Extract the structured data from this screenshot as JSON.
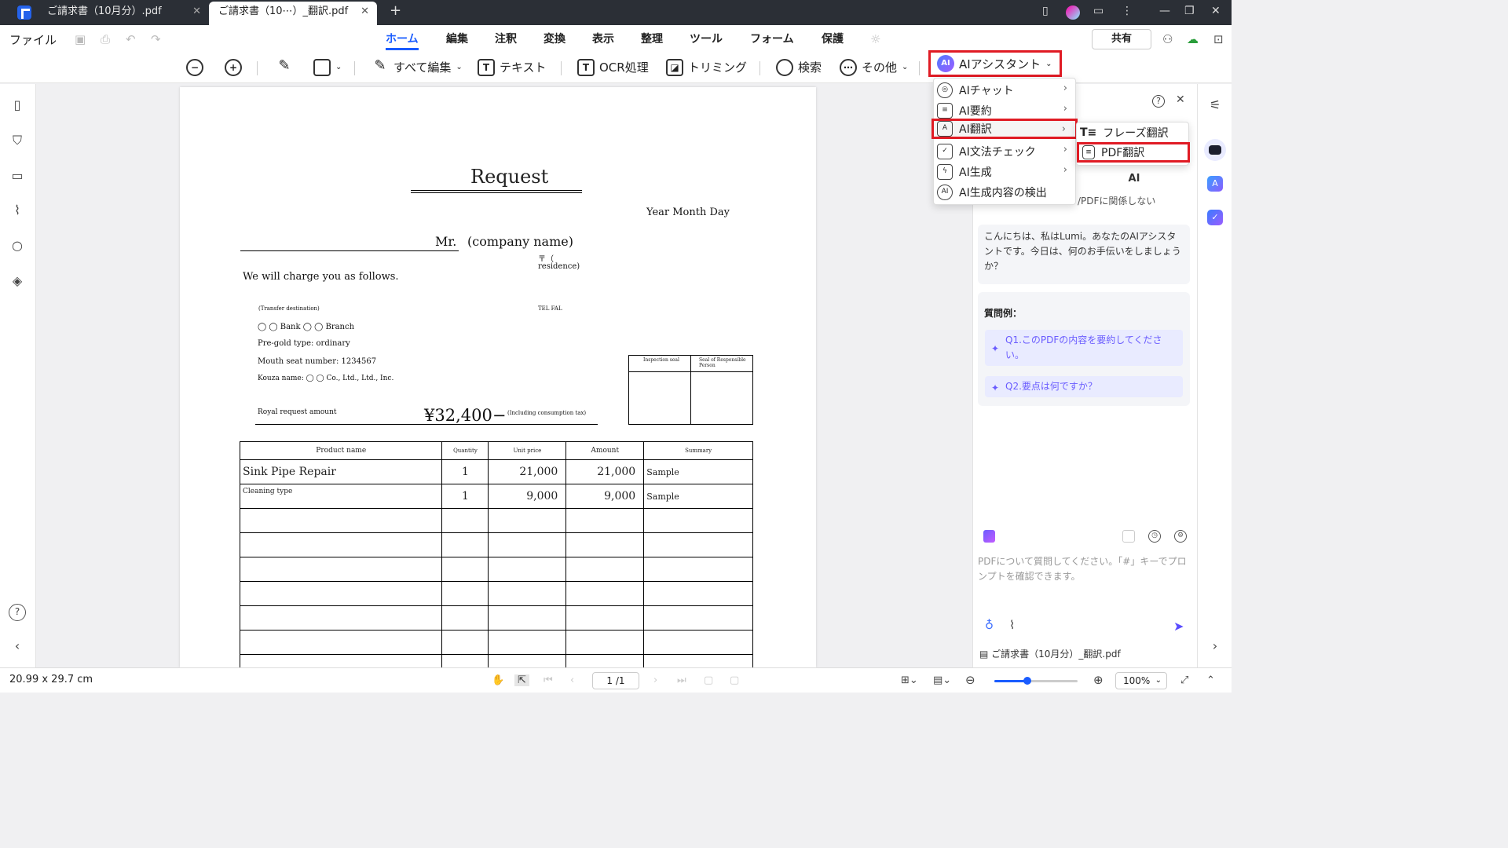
{
  "tabs": [
    {
      "label": "ご請求書（10月分）.pdf",
      "close": "✕"
    },
    {
      "label": "ご請求書（10⋯）_翻訳.pdf",
      "close": "✕"
    }
  ],
  "new_tab": "+",
  "menu": {
    "file": "ファイル",
    "tabs": [
      "ホーム",
      "編集",
      "注釈",
      "変換",
      "表示",
      "整理",
      "ツール",
      "フォーム",
      "保護"
    ],
    "share": "共有"
  },
  "toolbar": {
    "edit_all": "すべて編集",
    "text": "テキスト",
    "ocr": "OCR処理",
    "crop": "トリミング",
    "search": "検索",
    "more": "その他",
    "ai_assistant": "AIアシスタント",
    "ai_badge": "AI"
  },
  "ai_menu": {
    "items": [
      {
        "label": "AIチャット",
        "icon": "chat-icon",
        "has_sub": true
      },
      {
        "label": "AI要約",
        "icon": "summary-icon",
        "has_sub": true
      },
      {
        "label": "AI翻訳",
        "icon": "translate-icon",
        "has_sub": true
      },
      {
        "label": "AI文法チェック",
        "icon": "grammar-icon",
        "has_sub": true
      },
      {
        "label": "AI生成",
        "icon": "generate-icon",
        "has_sub": true
      },
      {
        "label": "AI生成内容の検出",
        "icon": "ai-detect-icon",
        "has_sub": false
      }
    ],
    "sub_items": [
      "フレーズ翻訳",
      "PDF翻訳"
    ],
    "arrow": "›"
  },
  "document": {
    "title": "Request",
    "date": "Year Month Day",
    "recipient_mr": "Mr.",
    "recipient_company": "(company name)",
    "postal": "〒（",
    "residence": "residence)",
    "charge_line": "We will charge you as follows.",
    "transfer": "(Transfer destination)",
    "tel_fax": "TEL FAL",
    "bank": "◯ ◯ Bank ◯ ◯ Branch",
    "deposit_type": "Pre-gold type: ordinary",
    "account_number": "Mouth seat number: 1234567",
    "account_name": "Kouza name: ◯ ◯ Co., Ltd., Ltd., Inc.",
    "request_amount_label": "Royal request amount",
    "request_amount": "¥32,400−",
    "tax_note": "(Including consumption tax)",
    "seal_inspection": "Inspection seal",
    "seal_responsible": "Seal of Responsible Person",
    "table_headers": [
      "Product name",
      "Quantity",
      "Unit price",
      "Amount",
      "Summary"
    ],
    "rows": [
      [
        "Sink Pipe Repair",
        "1",
        "21,000",
        "21,000",
        "Sample"
      ],
      [
        "Cleaning type",
        "1",
        "9,000",
        "9,000",
        "Sample"
      ]
    ]
  },
  "ai_panel": {
    "mode_ai": "AI",
    "notice": "/PDFに関係しない",
    "greeting": "こんにちは、私はLumi。あなたのAIアシスタントです。今日は、何のお手伝いをしましょうか？",
    "examples_title": "質問例：",
    "examples": [
      "Q1.このPDFの内容を要約してください。",
      "Q2.要点は何ですか？"
    ],
    "input_placeholder": "PDFについて質問してください。「#」キーでプロンプトを確認できます。",
    "file_name": "ご請求書（10月分）_翻訳.pdf"
  },
  "status": {
    "page_size": "20.99 x 29.7 cm",
    "page_indicator": "1 /1",
    "zoom": "100%",
    "zoom_level": 0.4
  },
  "colors": {
    "accent": "#1a5cff",
    "highlight": "#e01b24",
    "ai_purple": "#6a5cff"
  }
}
